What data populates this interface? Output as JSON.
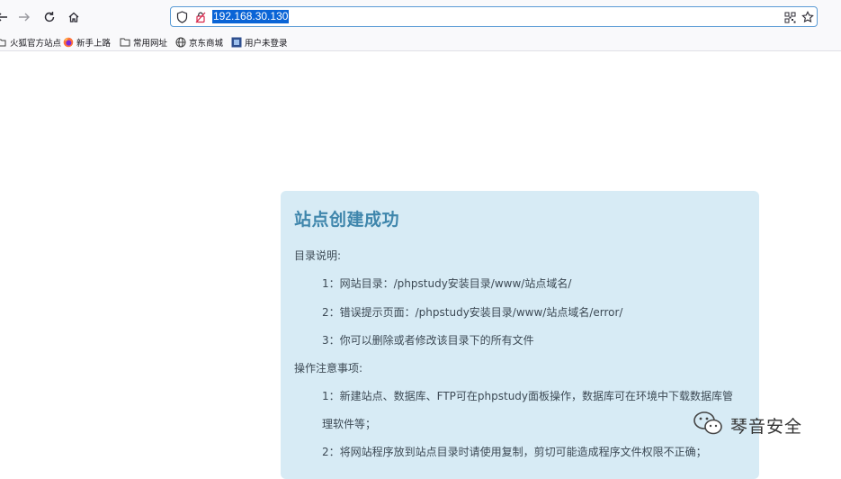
{
  "browser": {
    "url": "192.168.30.130",
    "icons": {
      "back": "back-icon",
      "forward": "forward-icon",
      "reload": "reload-icon",
      "home": "home-icon",
      "tracking": "shield-icon",
      "permissions": "identity-icon",
      "qr": "qr-code-icon",
      "bookmark": "star-icon"
    }
  },
  "bookmarks": [
    {
      "label": "火狐官方站点",
      "icon": "firefox-folder-icon"
    },
    {
      "label": "新手上路",
      "icon": "firefox-icon"
    },
    {
      "label": "常用网址",
      "icon": "folder-icon"
    },
    {
      "label": "京东商城",
      "icon": "globe-icon"
    },
    {
      "label": "用户未登录",
      "icon": "user-icon"
    }
  ],
  "page": {
    "title": "站点创建成功",
    "dir_heading": "目录说明:",
    "dir_items": [
      "1：网站目录：/phpstudy安装目录/www/站点域名/",
      "2：错误提示页面：/phpstudy安装目录/www/站点域名/error/",
      "3：你可以删除或者修改该目录下的所有文件"
    ],
    "notes_heading": "操作注意事项:",
    "notes_items": [
      "1：新建站点、数据库、FTP可在phpstudy面板操作，数据库可在环境中下载数据库管",
      "理软件等；",
      "2：将网站程序放到站点目录时请使用复制，剪切可能造成程序文件权限不正确；"
    ]
  },
  "watermark": {
    "text": "琴音安全",
    "icon": "wechat-icon"
  },
  "colors": {
    "card_bg": "#d7ebf5",
    "title": "#3f86ac",
    "url_highlight": "#0a64d6"
  }
}
